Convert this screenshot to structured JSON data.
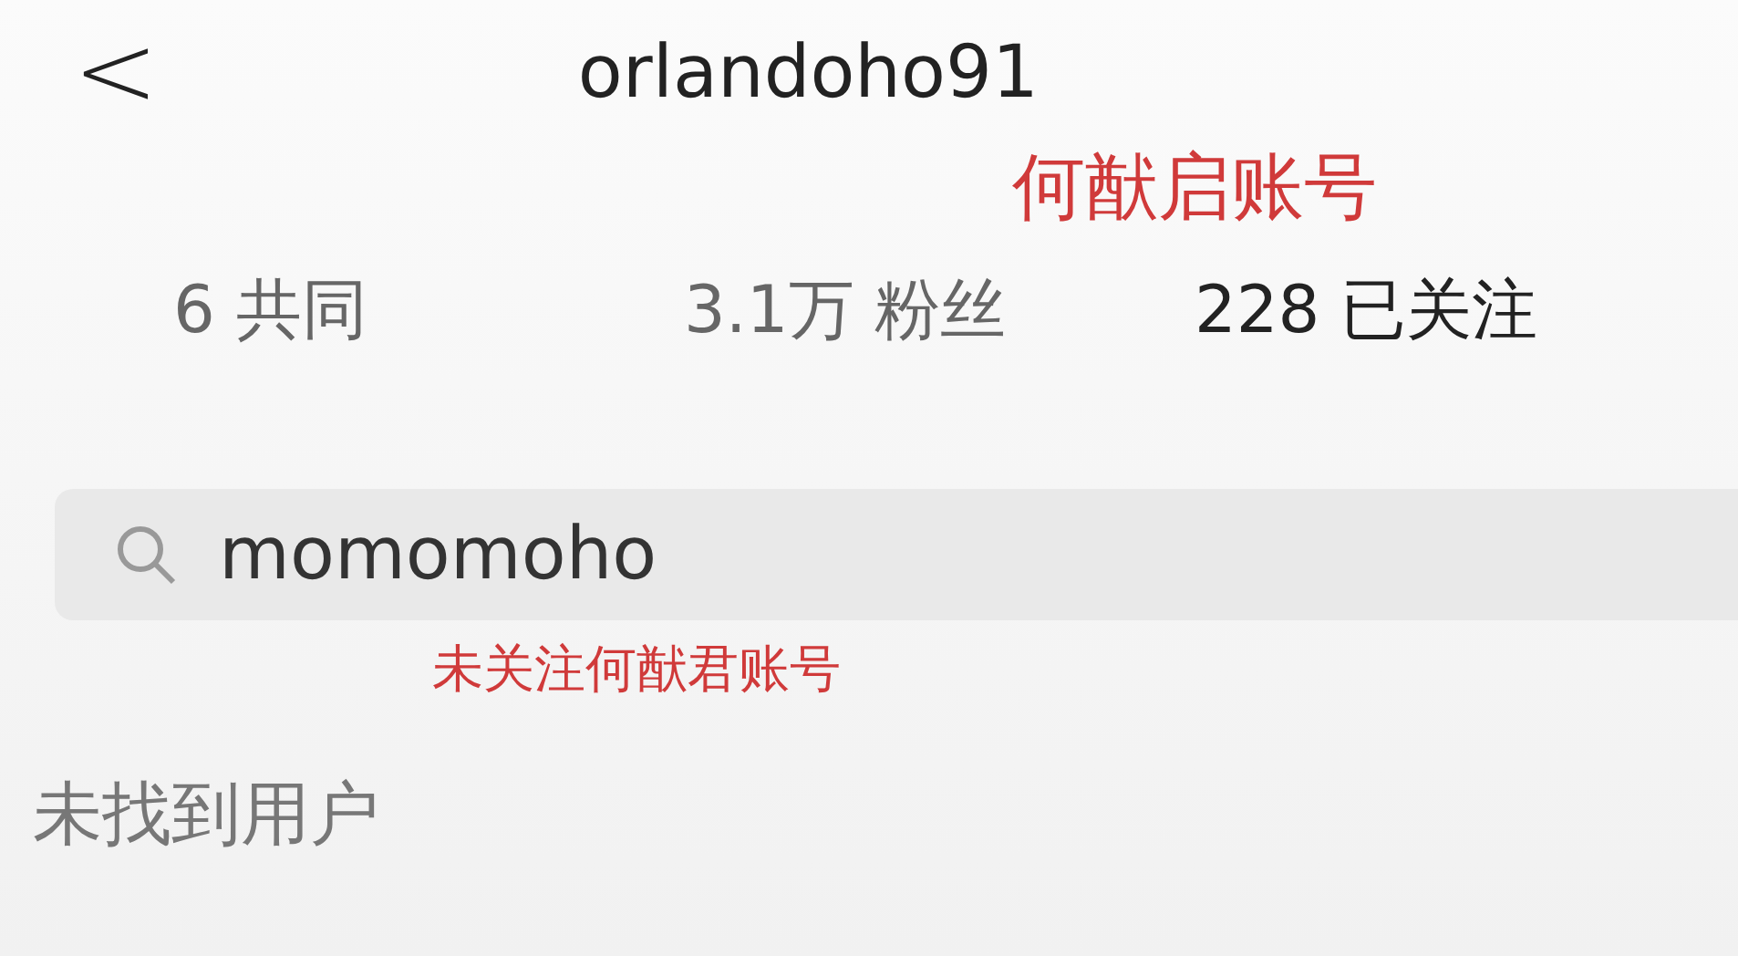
{
  "header": {
    "back": "<",
    "title": "orlandoho91"
  },
  "annotation_top": "何猷启账号",
  "stats": [
    {
      "value": "6",
      "label": "共同",
      "emphasis": false
    },
    {
      "value": "3.1万",
      "label": "粉丝",
      "emphasis": false
    },
    {
      "value": "228",
      "label": "已关注",
      "emphasis": true
    }
  ],
  "search": {
    "value": "momomoho"
  },
  "annotation_bottom": "未关注何猷君账号",
  "empty_message": "未找到用户"
}
